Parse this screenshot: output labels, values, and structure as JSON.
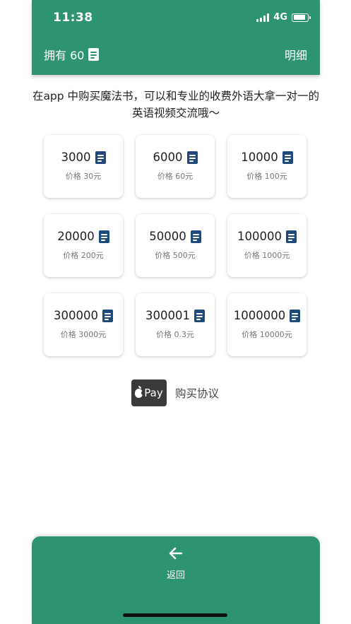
{
  "status": {
    "time": "11:38",
    "network": "4G"
  },
  "header": {
    "owned_label": "拥有 60",
    "details_label": "明细",
    "book_icon": "book-icon"
  },
  "intro": {
    "text": "在app 中购买魔法书，可以和专业的收费外语大拿一对一的英语视频交流哦～"
  },
  "packages": [
    {
      "amount": "3000",
      "price": "价格 30元"
    },
    {
      "amount": "6000",
      "price": "价格 60元"
    },
    {
      "amount": "10000",
      "price": "价格 100元"
    },
    {
      "amount": "20000",
      "price": "价格 200元"
    },
    {
      "amount": "50000",
      "price": "价格 500元"
    },
    {
      "amount": "100000",
      "price": "价格 1000元"
    },
    {
      "amount": "300000",
      "price": "价格 3000元"
    },
    {
      "amount": "300001",
      "price": "价格 0.3元"
    },
    {
      "amount": "1000000",
      "price": "价格 10000元"
    }
  ],
  "payment": {
    "apple_pay_label": "Pay",
    "agreement_label": "购买协议"
  },
  "bottom": {
    "back_label": "返回"
  },
  "colors": {
    "primary": "#2e9470",
    "book_blue": "#1d4a7a",
    "apple_pay_bg": "#3a3a3a"
  }
}
